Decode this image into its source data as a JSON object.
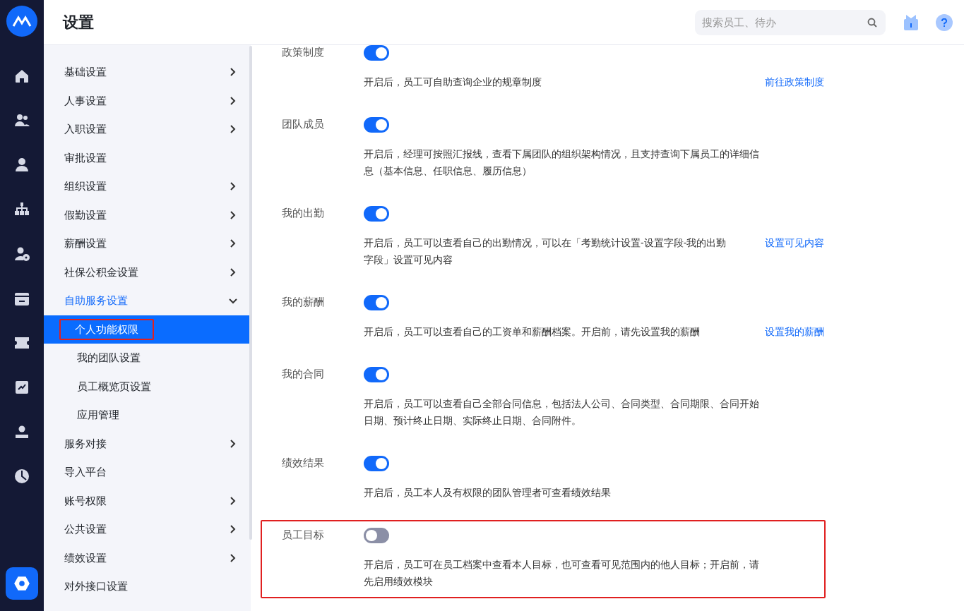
{
  "header": {
    "title": "设置",
    "search": {
      "placeholder": "搜索员工、待办"
    }
  },
  "sidebar": {
    "items": [
      {
        "label": "基础设置",
        "kind": "group",
        "expanded": false,
        "selected": false,
        "outlined": false
      },
      {
        "label": "人事设置",
        "kind": "group",
        "expanded": false,
        "selected": false,
        "outlined": false
      },
      {
        "label": "入职设置",
        "kind": "group",
        "expanded": false,
        "selected": false,
        "outlined": false
      },
      {
        "label": "审批设置",
        "kind": "link",
        "selected": false,
        "outlined": false
      },
      {
        "label": "组织设置",
        "kind": "group",
        "expanded": false,
        "selected": false,
        "outlined": false
      },
      {
        "label": "假勤设置",
        "kind": "group",
        "expanded": false,
        "selected": false,
        "outlined": false
      },
      {
        "label": "薪酬设置",
        "kind": "group",
        "expanded": false,
        "selected": false,
        "outlined": false
      },
      {
        "label": "社保公积金设置",
        "kind": "group",
        "expanded": false,
        "selected": false,
        "outlined": false
      },
      {
        "label": "自助服务设置",
        "kind": "group",
        "expanded": true,
        "selected": false,
        "outlined": false
      },
      {
        "label": "个人功能权限",
        "kind": "sub",
        "selected": true,
        "outlined": true
      },
      {
        "label": "我的团队设置",
        "kind": "sub",
        "selected": false,
        "outlined": false
      },
      {
        "label": "员工概览页设置",
        "kind": "sub",
        "selected": false,
        "outlined": false
      },
      {
        "label": "应用管理",
        "kind": "sub",
        "selected": false,
        "outlined": false
      },
      {
        "label": "服务对接",
        "kind": "group",
        "expanded": false,
        "selected": false,
        "outlined": false
      },
      {
        "label": "导入平台",
        "kind": "link",
        "selected": false,
        "outlined": false
      },
      {
        "label": "账号权限",
        "kind": "group",
        "expanded": false,
        "selected": false,
        "outlined": false
      },
      {
        "label": "公共设置",
        "kind": "group",
        "expanded": false,
        "selected": false,
        "outlined": false
      },
      {
        "label": "绩效设置",
        "kind": "group",
        "expanded": false,
        "selected": false,
        "outlined": false
      },
      {
        "label": "对外接口设置",
        "kind": "link",
        "selected": false,
        "outlined": false
      }
    ]
  },
  "settings": [
    {
      "label": "政策制度",
      "on": true,
      "description": "开启后，员工可自助查询企业的规章制度",
      "link": "前往政策制度",
      "outlined": false
    },
    {
      "label": "团队成员",
      "on": true,
      "description": "开启后，经理可按照汇报线，查看下属团队的组织架构情况，且支持查询下属员工的详细信息（基本信息、任职信息、履历信息）",
      "outlined": false
    },
    {
      "label": "我的出勤",
      "on": true,
      "description": "开启后，员工可以查看自己的出勤情况，可以在「考勤统计设置-设置字段-我的出勤字段」设置可见内容",
      "link": "设置可见内容",
      "outlined": false
    },
    {
      "label": "我的薪酬",
      "on": true,
      "description": "开启后，员工可以查看自己的工资单和薪酬档案。开启前，请先设置我的薪酬",
      "link": "设置我的薪酬",
      "outlined": false
    },
    {
      "label": "我的合同",
      "on": true,
      "description": "开启后，员工可以查看自己全部合同信息，包括法人公司、合同类型、合同期限、合同开始日期、预计终止日期、实际终止日期、合同附件。",
      "outlined": false
    },
    {
      "label": "绩效结果",
      "on": true,
      "description": "开启后，员工本人及有权限的团队管理者可查看绩效结果",
      "outlined": false
    },
    {
      "label": "员工目标",
      "on": false,
      "description": "开启后，员工可在员工档案中查看本人目标，也可查看可见范围内的他人目标；开启前，请先启用绩效模块",
      "outlined": true
    }
  ]
}
